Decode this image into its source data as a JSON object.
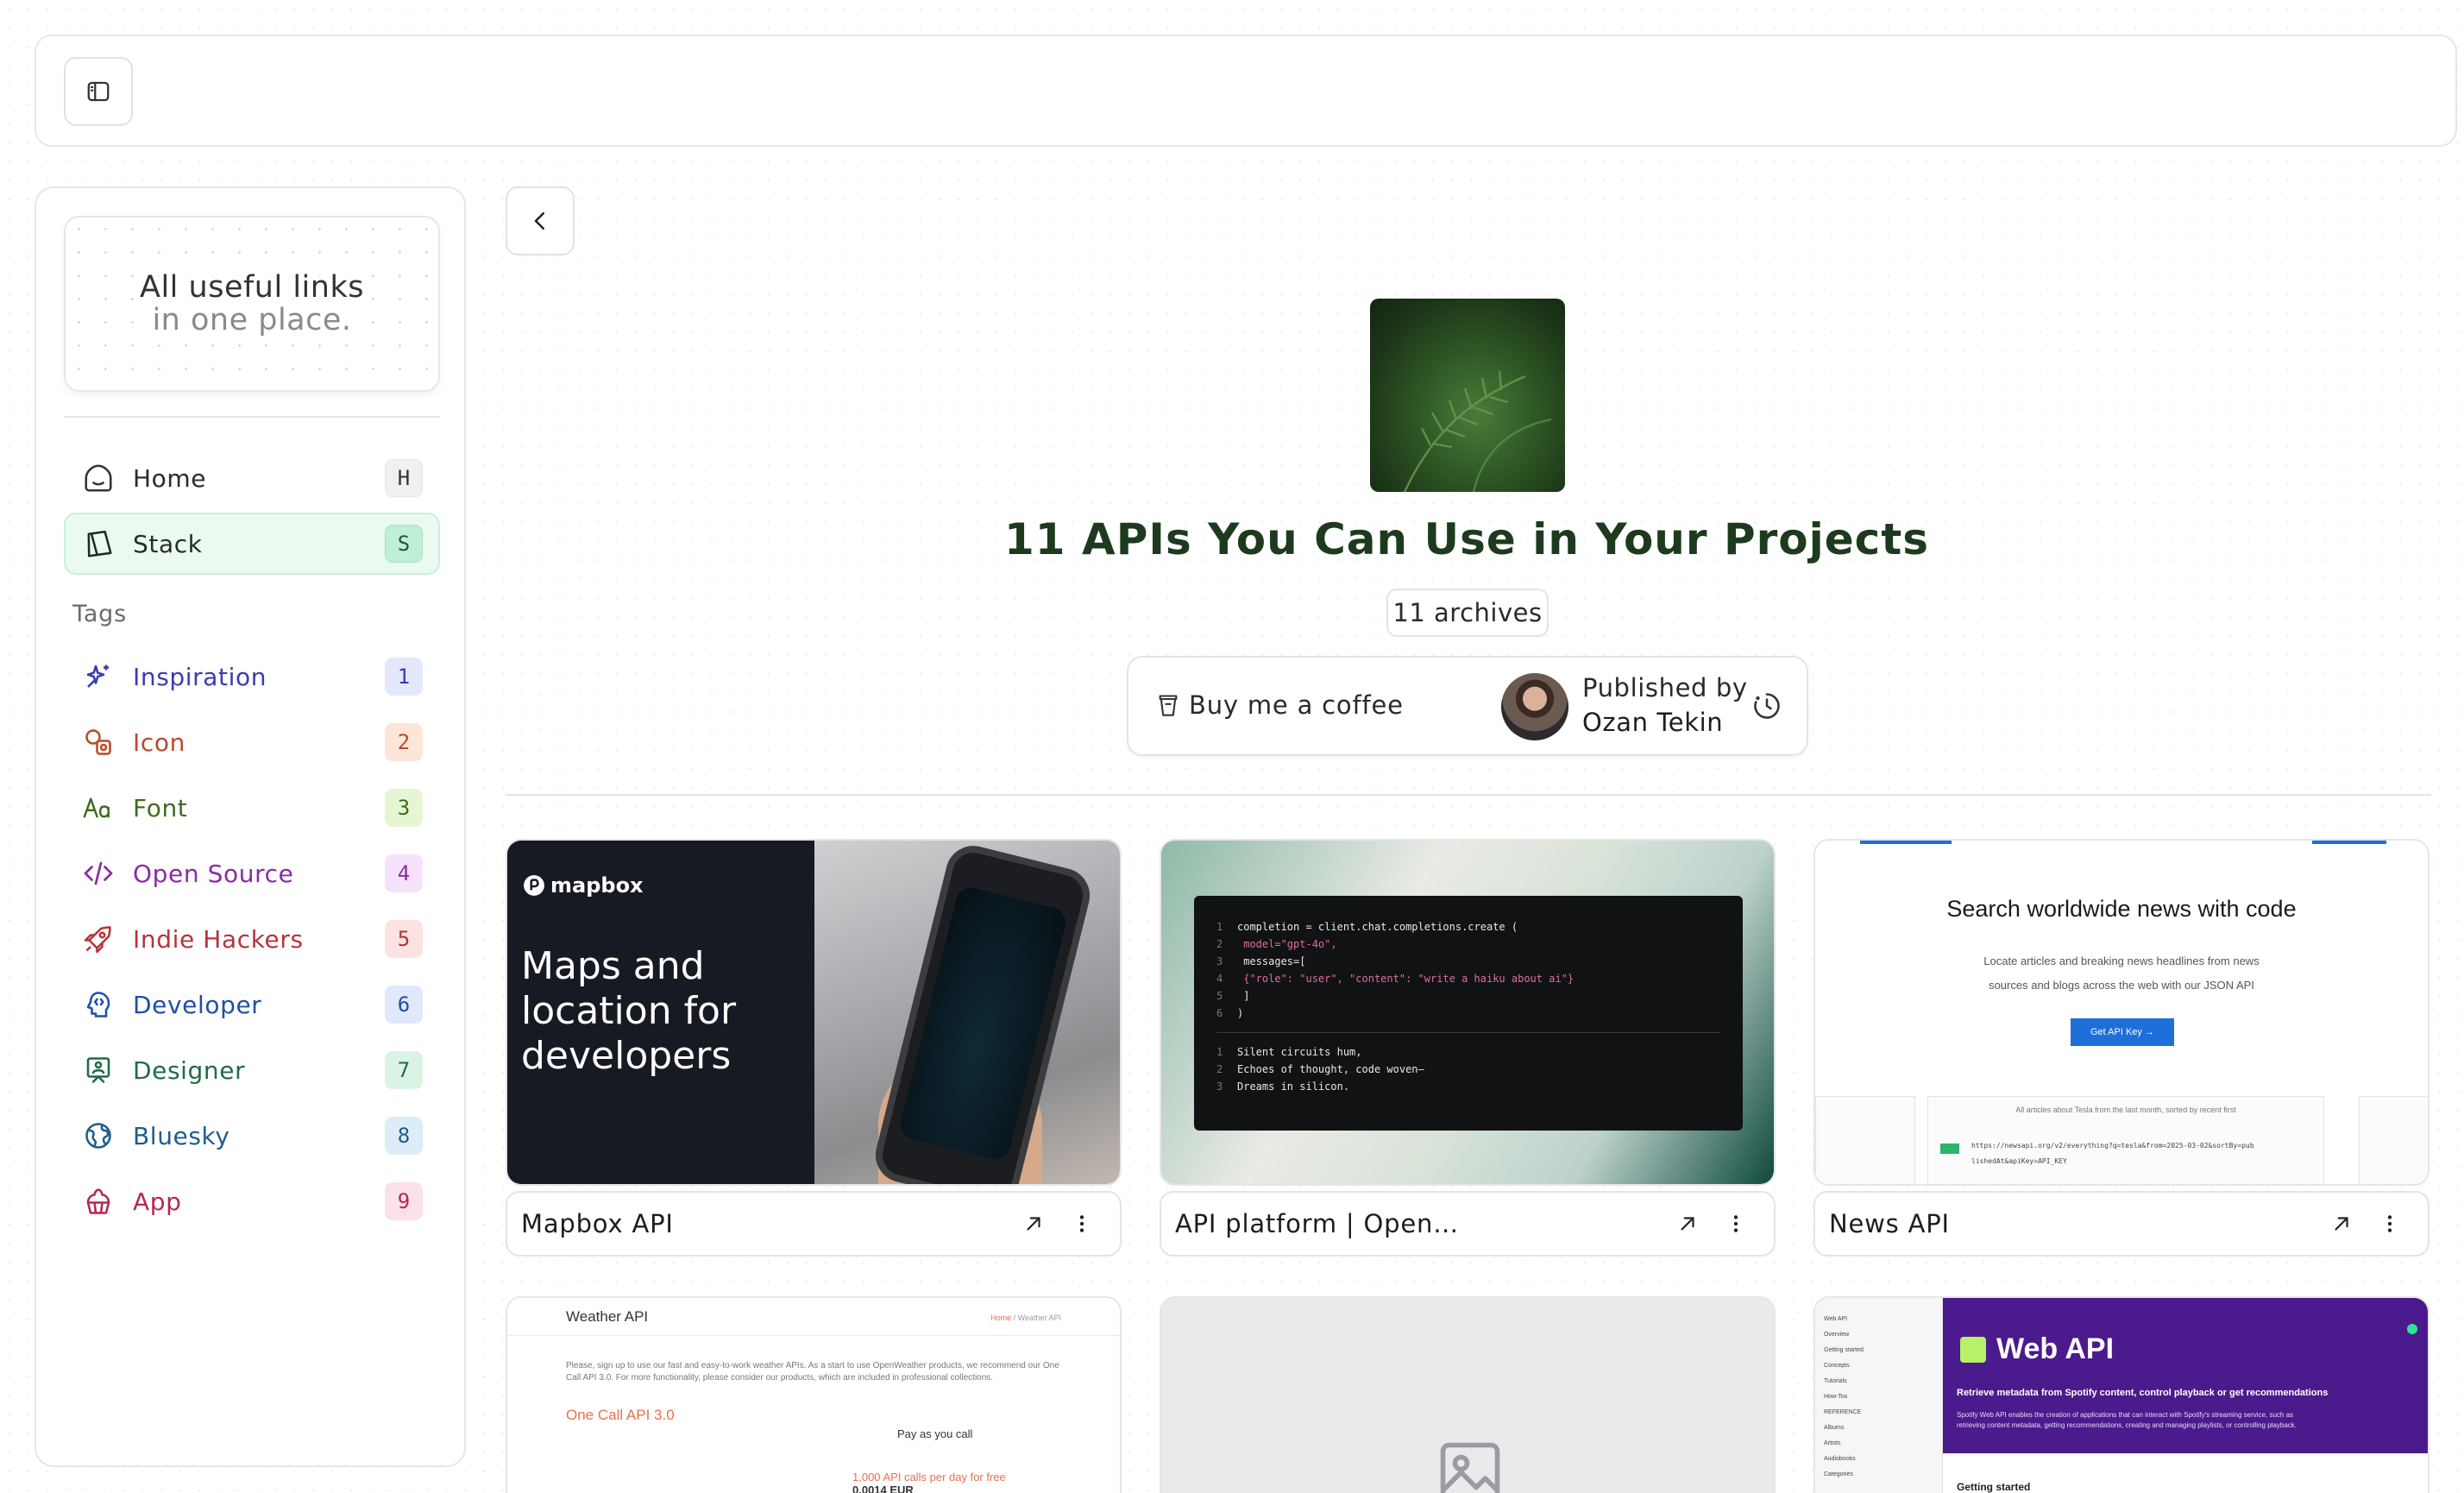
{
  "brand": {
    "line1": "All useful links",
    "line2": "in one place."
  },
  "nav": [
    {
      "label": "Home",
      "key": "H",
      "icon": "home-icon"
    },
    {
      "label": "Stack",
      "key": "S",
      "icon": "stack-icon",
      "active": true
    }
  ],
  "tags_title": "Tags",
  "tags": [
    {
      "label": "Inspiration",
      "count": "1",
      "color": "#3b3bb0",
      "badge_bg": "#e4e8fb",
      "icon": "sparkles-icon"
    },
    {
      "label": "Icon",
      "count": "2",
      "color": "#b84a2a",
      "badge_bg": "#fde6d8",
      "icon": "shapes-icon"
    },
    {
      "label": "Font",
      "count": "3",
      "color": "#3f6b21",
      "badge_bg": "#e6f6d2",
      "icon": "font-icon"
    },
    {
      "label": "Open Source",
      "count": "4",
      "color": "#8a2ba3",
      "badge_bg": "#f6e2fa",
      "icon": "code-icon"
    },
    {
      "label": "Indie Hackers",
      "count": "5",
      "color": "#b5343a",
      "badge_bg": "#fde2e2",
      "icon": "rocket-icon"
    },
    {
      "label": "Developer",
      "count": "6",
      "color": "#1f4fa8",
      "badge_bg": "#dfe9fb",
      "icon": "developer-icon"
    },
    {
      "label": "Designer",
      "count": "7",
      "color": "#1f6b47",
      "badge_bg": "#d9f4e5",
      "icon": "designer-icon"
    },
    {
      "label": "Bluesky",
      "count": "8",
      "color": "#1f5d8a",
      "badge_bg": "#dcedf8",
      "icon": "globe-icon"
    },
    {
      "label": "App",
      "count": "9",
      "color": "#b5284f",
      "badge_bg": "#fbe1e9",
      "icon": "cake-icon"
    }
  ],
  "page": {
    "title": "11 APIs You Can Use in Your Projects",
    "archives": "11 archives",
    "coffee": "Buy me a coffee",
    "published_by": "Published by",
    "author": "Ozan Tekin"
  },
  "cards": [
    {
      "title": "Mapbox API"
    },
    {
      "title": "API platform | Open…"
    },
    {
      "title": "News API"
    }
  ],
  "thumbs": {
    "mapbox": {
      "logo": "mapbox",
      "headline": "Maps and location for developers"
    },
    "openai": {
      "code": [
        [
          "1",
          "completion = client.chat.completions.create ("
        ],
        [
          "2",
          "  model=\"gpt-4o\","
        ],
        [
          "3",
          "  messages=["
        ],
        [
          "4",
          "    {\"role\": \"user\", \"content\": \"write a haiku about ai\"}"
        ],
        [
          "5",
          "  ]"
        ],
        [
          "6",
          ")"
        ]
      ],
      "output": [
        [
          "1",
          "Silent circuits hum,"
        ],
        [
          "2",
          "Echoes of thought, code woven—"
        ],
        [
          "3",
          "Dreams in silicon."
        ]
      ]
    },
    "news": {
      "title": "Search worldwide news with code",
      "sub1": "Locate articles and breaking news headlines from news",
      "sub2": "sources and blogs across the web with our JSON API",
      "button": "Get API Key →",
      "browser_caption": "All articles about Tesla from the last month, sorted by recent first",
      "code1": "https://newsapi.org/v2/everything?q=tesla&from=2025-03-02&sortBy=pub",
      "code2": "lishedAt&apiKey=API_KEY"
    },
    "weather": {
      "title": "Weather API",
      "crumb_home": "Home",
      "crumb_page": "/ Weather API",
      "text": "Please, sign up to use our fast and easy-to-work weather APIs. As a start to use OpenWeather products, we recommend our One Call API 3.0. For more functionality, please consider our products, which are included in professional collections.",
      "heading": "One Call API 3.0",
      "pay": "Pay as you call",
      "free": "1,000 API calls per day for free",
      "price": "0.0014 EUR"
    },
    "spotify": {
      "title": "Web API",
      "sub": "Retrieve metadata from Spotify content, control playback or get recommendations",
      "sub2": "Spotify Web API enables the creation of applications that can interact with Spotify's streaming service, such as retrieving content metadata, getting recommendations, creating and managing playlists, or controlling playback.",
      "side": [
        "Web API",
        "Overview",
        "Getting started",
        "Concepts",
        "Tutorials",
        "How-Tos",
        "REFERENCE",
        "Albums",
        "Artists",
        "Audiobooks",
        "Categories"
      ],
      "getting_started": "Getting started"
    }
  }
}
